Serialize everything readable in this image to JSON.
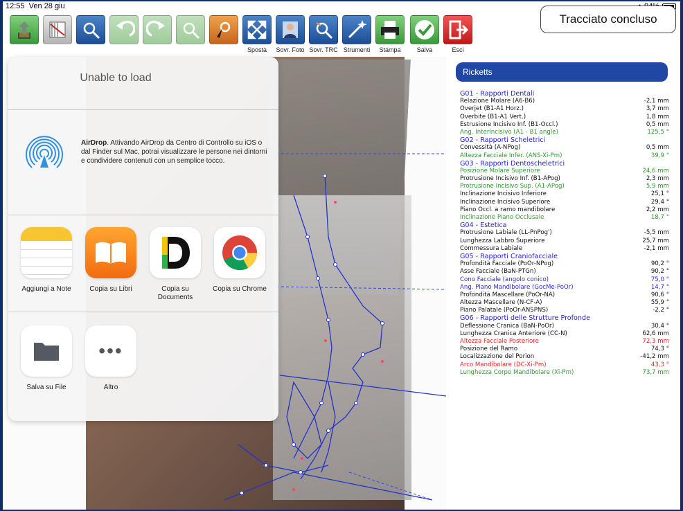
{
  "status_bar": {
    "time": "12:55",
    "date": "Ven 28 giu",
    "battery": "94%"
  },
  "toolbar": {
    "buttons": [
      {
        "label": "",
        "icon": "share-upload-icon",
        "color": "green"
      },
      {
        "label": "",
        "icon": "ruler-settings-icon",
        "color": "gray"
      },
      {
        "label": "",
        "icon": "landmark-target-icon",
        "color": "blue"
      },
      {
        "label": "",
        "icon": "undo-icon",
        "color": "pale-green"
      },
      {
        "label": "",
        "icon": "redo-icon",
        "color": "pale-green"
      },
      {
        "label": "",
        "icon": "landmark-move-icon",
        "color": "pale-green"
      },
      {
        "label": "",
        "icon": "landmark-pointer-icon",
        "color": "orange"
      },
      {
        "label": "Sposta",
        "icon": "move-arrows-icon",
        "color": "blue"
      },
      {
        "label": "Sovr. Foto",
        "icon": "photo-overlay-icon",
        "color": "blue"
      },
      {
        "label": "Sovr. TRC",
        "icon": "tracing-overlay-icon",
        "color": "blue"
      },
      {
        "label": "Strumenti",
        "icon": "magic-wand-icon",
        "color": "blue"
      },
      {
        "label": "Stampa",
        "icon": "printer-icon",
        "color": "green"
      },
      {
        "label": "Salva",
        "icon": "checkmark-icon",
        "color": "green"
      },
      {
        "label": "Esci",
        "icon": "exit-icon",
        "color": "red"
      }
    ],
    "traced_button": "Tracciato concluso"
  },
  "share_sheet": {
    "title": "Unable to load",
    "airdrop_title": "AirDrop",
    "airdrop_text": ". Attivando AirDrop da Centro di Controllo su iOS o dal Finder sul Mac, potrai visualizzare le persone nei dintorni e condividere contenuti con un semplice tocco.",
    "apps": [
      {
        "label": "Aggiungi a Note",
        "icon": "notes-app-icon"
      },
      {
        "label": "Copia su Libri",
        "icon": "books-app-icon"
      },
      {
        "label": "Copia su Documents",
        "icon": "documents-app-icon"
      },
      {
        "label": "Copia su Chrome",
        "icon": "chrome-app-icon"
      }
    ],
    "actions": [
      {
        "label": "Salva su File",
        "icon": "folder-icon"
      },
      {
        "label": "Altro",
        "icon": "more-dots-icon"
      }
    ]
  },
  "analysis": {
    "title": "Ricketts",
    "rows": [
      {
        "kind": "group",
        "name": "G01 - Rapporti Dentali",
        "value": "",
        "color": "blue"
      },
      {
        "kind": "item",
        "name": "Relazione Molare (A6-B6)",
        "value": "-2,1 mm",
        "color": "black"
      },
      {
        "kind": "item",
        "name": "Overjet (B1-A1 Horz.)",
        "value": "3,7 mm",
        "color": "black"
      },
      {
        "kind": "item",
        "name": "Overbite (B1-A1 Vert.)",
        "value": "1,8 mm",
        "color": "black"
      },
      {
        "kind": "item",
        "name": "Estrusione Incisivo Inf. (B1-Occl.)",
        "value": "0,5 mm",
        "color": "black"
      },
      {
        "kind": "item",
        "name": "Ang. Interincisivo (A1 - B1 angle)",
        "value": "125,5 °",
        "color": "green"
      },
      {
        "kind": "group",
        "name": "G02 - Rapporti Scheletrici",
        "value": "",
        "color": "blue"
      },
      {
        "kind": "item",
        "name": "Convessità (A-NPog)",
        "value": "0,5 mm",
        "color": "black"
      },
      {
        "kind": "item",
        "name": "Altezza Facciale Infer. (ANS-Xi-Pm)",
        "value": "39,9 °",
        "color": "green"
      },
      {
        "kind": "group",
        "name": "G03 - Rapporti Dentoscheletrici",
        "value": "",
        "color": "blue"
      },
      {
        "kind": "item",
        "name": "Posizione Molare Superiore",
        "value": "24,6 mm",
        "color": "green"
      },
      {
        "kind": "item",
        "name": "Protrusione Incisivo Inf. (B1-APog)",
        "value": "2,3 mm",
        "color": "black"
      },
      {
        "kind": "item",
        "name": "Protrusione Incisivo Sup. (A1-APog)",
        "value": "5,9 mm",
        "color": "green"
      },
      {
        "kind": "item",
        "name": "Inclinazione Incisivo Inferiore",
        "value": "25,1 °",
        "color": "black"
      },
      {
        "kind": "item",
        "name": "Inclinazione Incisivo Superiore",
        "value": "29,4 °",
        "color": "black"
      },
      {
        "kind": "item",
        "name": "Piano Occl. a ramo mandibolare",
        "value": "2,2 mm",
        "color": "black"
      },
      {
        "kind": "item",
        "name": "Inclinazione Piano Occlusale",
        "value": "18,7 °",
        "color": "green"
      },
      {
        "kind": "group",
        "name": "G04 - Estetica",
        "value": "",
        "color": "blue"
      },
      {
        "kind": "item",
        "name": "Protrusione Labiale (LL-PnPog')",
        "value": "-5,5 mm",
        "color": "black"
      },
      {
        "kind": "item",
        "name": "Lunghezza Labbro Superiore",
        "value": "25,7 mm",
        "color": "black"
      },
      {
        "kind": "item",
        "name": "Commessura Labiale",
        "value": "-2,1 mm",
        "color": "black"
      },
      {
        "kind": "group",
        "name": "G05 - Rapporti Craniofacciale",
        "value": "",
        "color": "blue"
      },
      {
        "kind": "item",
        "name": "Profondità Facciale (PoOr-NPog)",
        "value": "90,2 °",
        "color": "black"
      },
      {
        "kind": "item",
        "name": "Asse Facciale (BaN-PTGn)",
        "value": "90,2 °",
        "color": "black"
      },
      {
        "kind": "item",
        "name": "Cono Facciale (angolo conico)",
        "value": "75,0 °",
        "color": "bluetxt"
      },
      {
        "kind": "item",
        "name": "Ang. Piano Mandibolare (GocMe-PoOr)",
        "value": "14,7 °",
        "color": "bluetxt"
      },
      {
        "kind": "item",
        "name": "Profondità Mascellare (PoOr-NA)",
        "value": "90,6 °",
        "color": "black"
      },
      {
        "kind": "item",
        "name": "Altezza Mascellare (N-CF-A)",
        "value": "55,9 °",
        "color": "black"
      },
      {
        "kind": "item",
        "name": "Piano Palatale (PoOr-ANSPNS)",
        "value": "-2,2 °",
        "color": "black"
      },
      {
        "kind": "group",
        "name": "G06 - Rapporti delle Strutture Profonde",
        "value": "",
        "color": "blue"
      },
      {
        "kind": "item",
        "name": "Deflessione Cranica (BaN-PoOr)",
        "value": "30,4 °",
        "color": "black"
      },
      {
        "kind": "item",
        "name": "Lunghezza Cranica Anteriore (CC-N)",
        "value": "62,6 mm",
        "color": "black"
      },
      {
        "kind": "item",
        "name": "Altezza Facciale Posteriore",
        "value": "72,3 mm",
        "color": "red"
      },
      {
        "kind": "item",
        "name": "Posizione del Ramo",
        "value": "74,3 °",
        "color": "black"
      },
      {
        "kind": "item",
        "name": "Localizzazione del Porion",
        "value": "-41,2 mm",
        "color": "black"
      },
      {
        "kind": "item",
        "name": "Arco Mandibolare (DC-Xi-Pm)",
        "value": "43,3 °",
        "color": "red"
      },
      {
        "kind": "item",
        "name": "Lunghezza Corpo Mandibolare (Xi-Pm)",
        "value": "73,7 mm",
        "color": "green"
      }
    ]
  }
}
